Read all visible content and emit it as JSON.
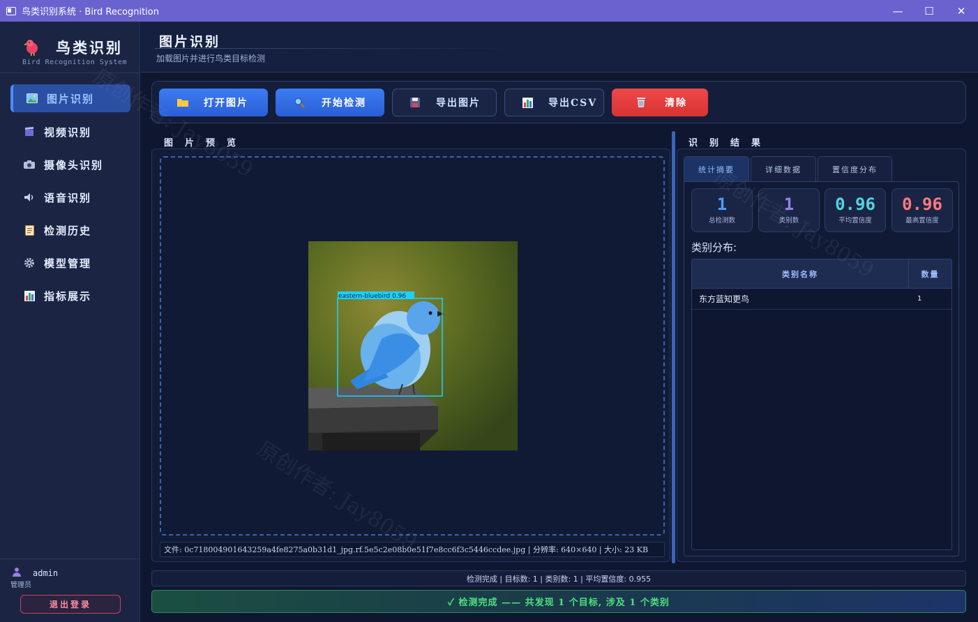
{
  "window": {
    "title": "鸟类识别系统 · Bird Recognition",
    "minimize": "—",
    "maximize": "☐",
    "close": "✕"
  },
  "sidebar": {
    "logo_title": "鸟类识别",
    "logo_subtitle": "Bird Recognition System",
    "items": [
      {
        "label": "图片识别",
        "icon": "image-icon",
        "active": true
      },
      {
        "label": "视频识别",
        "icon": "clapper-icon",
        "active": false
      },
      {
        "label": "摄像头识别",
        "icon": "camera-icon",
        "active": false
      },
      {
        "label": "语音识别",
        "icon": "speaker-icon",
        "active": false
      },
      {
        "label": "检测历史",
        "icon": "clipboard-icon",
        "active": false
      },
      {
        "label": "模型管理",
        "icon": "gear-icon",
        "active": false
      },
      {
        "label": "指标展示",
        "icon": "bar-chart-icon",
        "active": false
      }
    ],
    "user": {
      "name": "admin",
      "role": "管理员"
    },
    "logout_label": "退出登录"
  },
  "header": {
    "title": "图片识别",
    "subtitle": "加载图片并进行鸟类目标检测"
  },
  "toolbar": {
    "open_label": "打开图片",
    "detect_label": "开始检测",
    "export_image_label": "导出图片",
    "export_csv_label": "导出CSV",
    "clear_label": "清除"
  },
  "preview": {
    "section_title": "图片预览",
    "detection_label": "eastern-bluebird 0.96",
    "detection_confidence": 0.96,
    "file_info": "文件: 0c718004901643259a4fe8275a0b31d1_jpg.rf.5e5c2e08b0e51f7e8cc6f3c5446ccdee.jpg  |  分辨率: 640×640  |  大小: 23 KB"
  },
  "results": {
    "section_title": "识别结果",
    "tabs": [
      "统计摘要",
      "详细数据",
      "置信度分布"
    ],
    "active_tab": 0,
    "stats": [
      {
        "value": "1",
        "label": "总检测数",
        "color": "#4d9bff"
      },
      {
        "value": "1",
        "label": "类别数",
        "color": "#9b7ee8"
      },
      {
        "value": "0.96",
        "label": "平均置信度",
        "color": "#4fd6e0"
      },
      {
        "value": "0.96",
        "label": "最高置信度",
        "color": "#ff7b7b"
      }
    ],
    "distribution_label": "类别分布:",
    "table": {
      "headers": [
        "类别名称",
        "数量"
      ],
      "rows": [
        [
          "东方蓝知更鸟",
          "1"
        ]
      ]
    }
  },
  "status": {
    "line": "检测完成 | 目标数: 1 | 类别数: 1 | 平均置信度: 0.955",
    "success": "✓  检测完成 —— 共发现 1 个目标, 涉及 1 个类别"
  },
  "watermark": "原创作者: Jay8059"
}
